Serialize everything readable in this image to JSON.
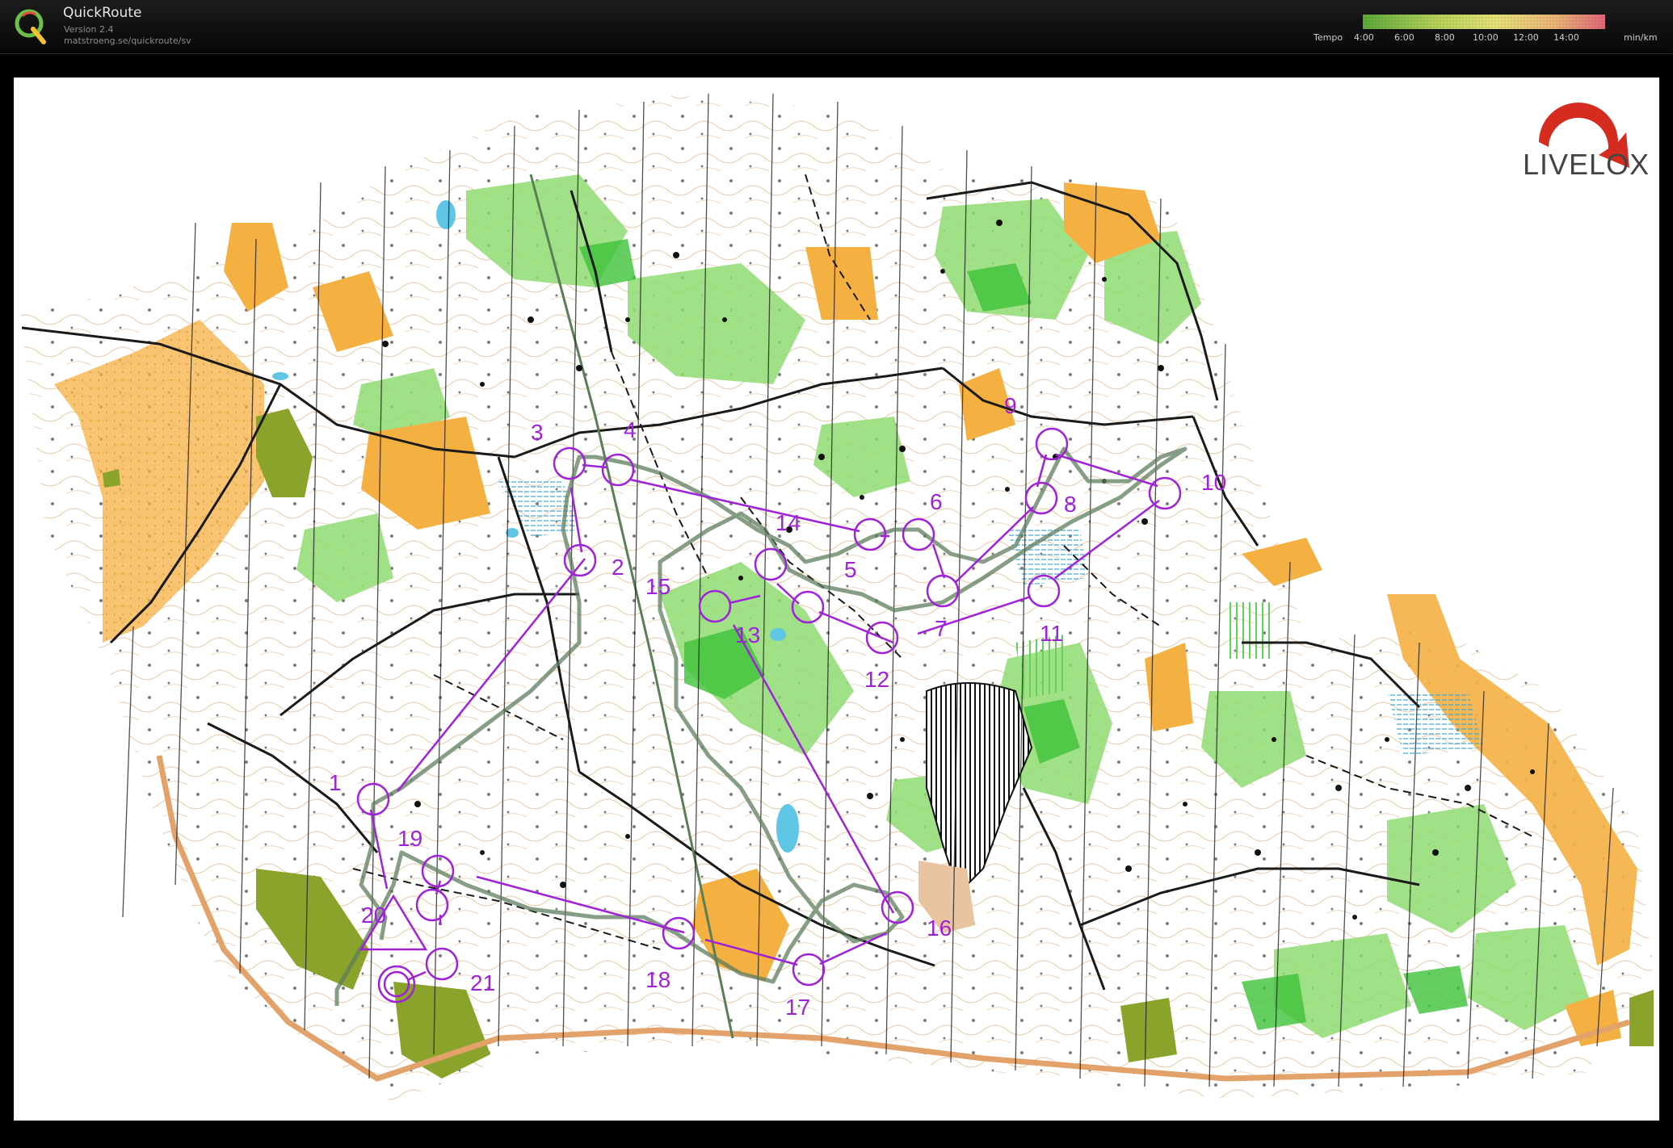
{
  "app": {
    "title": "QuickRoute",
    "version": "Version 2.4",
    "url": "matstroeng.se/quickroute/sv",
    "logo_icon": "quickroute-q-icon"
  },
  "tempo_legend": {
    "label": "Tempo",
    "ticks": [
      "4:00",
      "6:00",
      "8:00",
      "10:00",
      "12:00",
      "14:00"
    ],
    "unit": "min/km",
    "gradient_colors": [
      "#5fae3c",
      "#b9d65a",
      "#ece77a",
      "#efb77a",
      "#e66a7a"
    ]
  },
  "brand": {
    "name": "LIVELOX",
    "icon": "livelox-arrow-icon",
    "arrow_color": "#d62b1f"
  },
  "course": {
    "line_color": "#a022d8",
    "route_color": "#5e7d5e",
    "start": "start-triangle-icon",
    "finish": "finish-double-circle-icon",
    "controls": [
      "1",
      "2",
      "3",
      "4",
      "5",
      "6",
      "7",
      "8",
      "9",
      "10",
      "11",
      "12",
      "13",
      "14",
      "15",
      "16",
      "17",
      "18",
      "19",
      "20",
      "21"
    ]
  },
  "map_colors": {
    "open": "#f5b042",
    "forest_green": "#8fdc72",
    "dark_green": "#3fc23a",
    "urban": "#8aa32a",
    "water": "#5fc6e6",
    "contour": "#c9894b",
    "track": "#1a1a1a",
    "road": "#e2a26a"
  }
}
